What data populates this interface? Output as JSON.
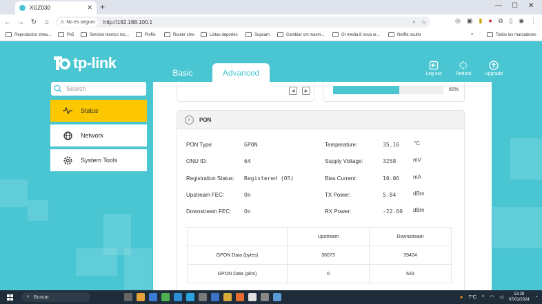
{
  "browser": {
    "tab_title": "XGZ030",
    "new_tab": "+",
    "security_label": "No es seguro",
    "url": "http://192.168.100.1",
    "bookmarks": [
      "Reproductor strea...",
      "Px5",
      "Servicio tecnico roc...",
      "Pixflix",
      "Router cmo",
      "Listas deportes",
      "Supcam",
      "Cambiar cnt masm...",
      "Gt media 8 nova or...",
      "Netflix oculto"
    ],
    "all_bookmarks": "Todos los marcadores",
    "more": "»"
  },
  "header": {
    "brand": "tp-link",
    "tabs": {
      "basic": "Basic",
      "advanced": "Advanced"
    },
    "actions": {
      "logout": "Log out",
      "reboot": "Reboot",
      "upgrade": "Upgrade"
    }
  },
  "sidebar": {
    "search_placeholder": "Search",
    "items": [
      {
        "label": "Status",
        "icon": "pulse-icon",
        "active": true
      },
      {
        "label": "Network",
        "icon": "globe-icon",
        "active": false
      },
      {
        "label": "System Tools",
        "icon": "gear-icon",
        "active": false
      }
    ]
  },
  "prev_section": {
    "progress_percent": 60,
    "progress_label": "60%"
  },
  "help_label": "?",
  "pon": {
    "title": "PON",
    "left": [
      {
        "label": "PON Type:",
        "value": "GPON"
      },
      {
        "label": "ONU ID:",
        "value": "64"
      },
      {
        "label": "Registration Status:",
        "value": "Registered (O5)"
      },
      {
        "label": "Upstream FEC:",
        "value": "On"
      },
      {
        "label": "Downstream FEC:",
        "value": "On"
      }
    ],
    "right": [
      {
        "label": "Temperature:",
        "value": "35.16",
        "unit": "°C"
      },
      {
        "label": "Supply Voltage:",
        "value": "3258",
        "unit": "mV"
      },
      {
        "label": "Bias Current:",
        "value": "10.06",
        "unit": "mA"
      },
      {
        "label": "TX Power:",
        "value": "5.84",
        "unit": "dBm"
      },
      {
        "label": "RX Power:",
        "value": "-22.60",
        "unit": "dBm"
      }
    ],
    "table": {
      "headers": [
        "",
        "Upstream",
        "Downstream"
      ],
      "rows": [
        [
          "GPON Data (bytes)",
          "36073",
          "39404"
        ],
        [
          "GPON Data (pkts)",
          "0",
          "633"
        ]
      ]
    }
  },
  "taskbar": {
    "search": "Buscar",
    "temperature": "7°C",
    "time": "13:28",
    "date": "07/01/2024"
  }
}
